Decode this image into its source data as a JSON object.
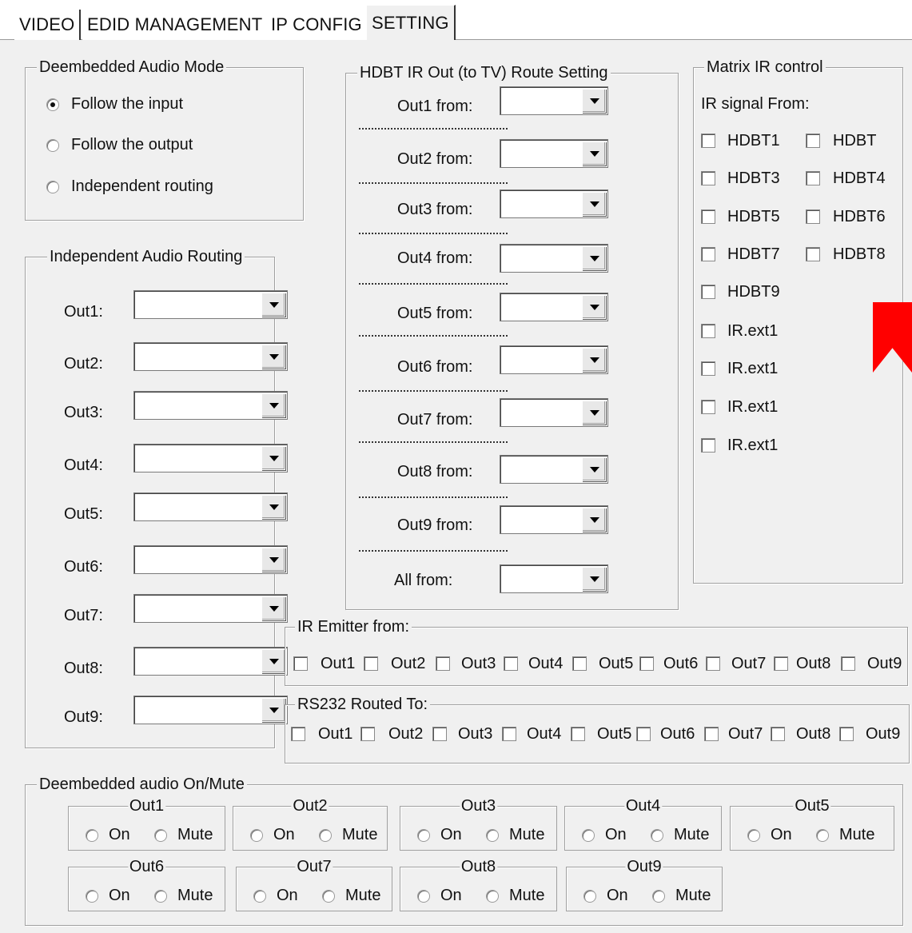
{
  "tabs": [
    {
      "label": "VIDEO",
      "active": false
    },
    {
      "label": "EDID MANAGEMENT",
      "active": false
    },
    {
      "label": "IP CONFIG",
      "active": false
    },
    {
      "label": "SETTING",
      "active": true
    }
  ],
  "deembedded_mode": {
    "title": "Deembedded Audio Mode",
    "options": [
      {
        "label": "Follow the input",
        "checked": true
      },
      {
        "label": "Follow the output",
        "checked": false
      },
      {
        "label": "Independent routing",
        "checked": false
      }
    ]
  },
  "independent_routing": {
    "title": "Independent Audio Routing",
    "outputs": [
      "Out1:",
      "Out2:",
      "Out3:",
      "Out4:",
      "Out5:",
      "Out6:",
      "Out7:",
      "Out8:",
      "Out9:"
    ]
  },
  "hdbt_ir": {
    "title": "HDBT IR Out (to TV) Route Setting",
    "rows": [
      "Out1 from:",
      "Out2 from:",
      "Out3 from:",
      "Out4 from:",
      "Out5 from:",
      "Out6 from:",
      "Out7 from:",
      "Out8 from:",
      "Out9 from:",
      "All from:"
    ]
  },
  "matrix_ir": {
    "title": "Matrix IR control",
    "subtitle": "IR signal From:",
    "checkboxes": [
      "HDBT1",
      "HDBT",
      "HDBT3",
      "HDBT4",
      "HDBT5",
      "HDBT6",
      "HDBT7",
      "HDBT8",
      "HDBT9",
      "IR.ext1",
      "IR.ext1",
      "IR.ext1",
      "IR.ext1"
    ]
  },
  "ir_emitter": {
    "title": "IR Emitter from:",
    "items": [
      "Out1",
      "Out2",
      "Out3",
      "Out4",
      "Out5",
      "Out6",
      "Out7",
      "Out8",
      "Out9"
    ]
  },
  "rs232": {
    "title": "RS232 Routed To:",
    "items": [
      "Out1",
      "Out2",
      "Out3",
      "Out4",
      "Out5",
      "Out6",
      "Out7",
      "Out8",
      "Out9"
    ]
  },
  "onmute": {
    "title": "Deembedded audio On/Mute",
    "on_label": "On",
    "mute_label": "Mute",
    "outputs": [
      "Out1",
      "Out2",
      "Out3",
      "Out4",
      "Out5",
      "Out6",
      "Out7",
      "Out8",
      "Out9"
    ]
  },
  "colors": {
    "bookmark": "#ff0000",
    "background": "#f0f0f0"
  },
  "icons": {
    "bookmark": "bookmark-icon"
  }
}
